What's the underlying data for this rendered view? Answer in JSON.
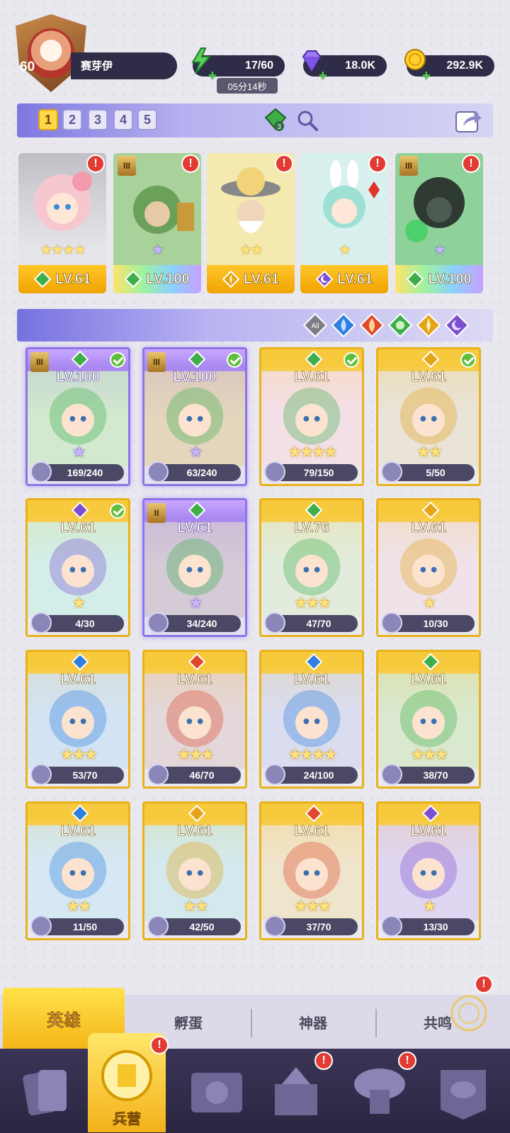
{
  "player": {
    "level": "60",
    "name": "赛芽伊"
  },
  "resources": {
    "energy": "17/60",
    "energy_timer": "05分14秒",
    "gems": "18.0K",
    "coins": "292.9K"
  },
  "team_tabs": [
    "1",
    "2",
    "3",
    "4",
    "5"
  ],
  "team_active_tab": "1",
  "team_gem_count": "3",
  "colors": {
    "green_element": "#3fae4a",
    "blue_element": "#2f7ee0",
    "red_element": "#e0482a",
    "gold_element": "#e5a31a",
    "purple_element": "#7a4fd0",
    "alert_red": "#e23b34",
    "nav_bg": "#2a2641",
    "accent_yellow": "#f5b619"
  },
  "team": [
    {
      "level": "LV.61",
      "element": "green",
      "stars": "★★★★",
      "alert": "!",
      "rank": ""
    },
    {
      "level": "LV.100",
      "element": "green",
      "stars": "★",
      "alert": "!",
      "rank": "III"
    },
    {
      "level": "LV.61",
      "element": "gold",
      "stars": "★★",
      "alert": "!",
      "rank": ""
    },
    {
      "level": "LV.61",
      "element": "purple",
      "stars": "★",
      "alert": "!",
      "rank": ""
    },
    {
      "level": "LV.100",
      "element": "green",
      "stars": "★",
      "alert": "!",
      "rank": "III"
    }
  ],
  "filter": {
    "all_label": "All",
    "elements": [
      "blue-element-icon",
      "red-element-icon",
      "green-element-icon",
      "gold-element-icon",
      "purple-element-icon"
    ]
  },
  "heroes": [
    {
      "level": "LV.100",
      "element": "green",
      "shards": "169/240",
      "frame": "purple",
      "check": true,
      "rank": "III",
      "stars": "★"
    },
    {
      "level": "LV.100",
      "element": "green",
      "shards": "63/240",
      "frame": "purple",
      "check": true,
      "rank": "III",
      "stars": "★"
    },
    {
      "level": "LV.61",
      "element": "green",
      "shards": "79/150",
      "frame": "gold",
      "check": true,
      "rank": "",
      "stars": "★★★★"
    },
    {
      "level": "LV.61",
      "element": "gold",
      "shards": "5/50",
      "frame": "gold",
      "check": true,
      "rank": "",
      "stars": "★★"
    },
    {
      "level": "LV.61",
      "element": "purple",
      "shards": "4/30",
      "frame": "gold",
      "check": true,
      "rank": "",
      "stars": "★"
    },
    {
      "level": "LV.61",
      "element": "green",
      "shards": "34/240",
      "frame": "purple",
      "check": false,
      "rank": "II",
      "stars": "★"
    },
    {
      "level": "LV.76",
      "element": "green",
      "shards": "47/70",
      "frame": "gold",
      "check": false,
      "rank": "",
      "stars": "★★★"
    },
    {
      "level": "LV.61",
      "element": "gold",
      "shards": "10/30",
      "frame": "gold",
      "check": false,
      "rank": "",
      "stars": "★"
    },
    {
      "level": "LV.61",
      "element": "blue",
      "shards": "53/70",
      "frame": "gold",
      "check": false,
      "rank": "",
      "stars": "★★★"
    },
    {
      "level": "LV.61",
      "element": "red",
      "shards": "46/70",
      "frame": "gold",
      "check": false,
      "rank": "",
      "stars": "★★★"
    },
    {
      "level": "LV.61",
      "element": "blue",
      "shards": "24/100",
      "frame": "gold",
      "check": false,
      "rank": "",
      "stars": "★★★★"
    },
    {
      "level": "LV.61",
      "element": "green",
      "shards": "38/70",
      "frame": "gold",
      "check": false,
      "rank": "",
      "stars": "★★★"
    },
    {
      "level": "LV.61",
      "element": "blue",
      "shards": "11/50",
      "frame": "gold",
      "check": false,
      "rank": "",
      "stars": "★★"
    },
    {
      "level": "LV.61",
      "element": "gold",
      "shards": "42/50",
      "frame": "gold",
      "check": false,
      "rank": "",
      "stars": "★★"
    },
    {
      "level": "LV.61",
      "element": "red",
      "shards": "37/70",
      "frame": "gold",
      "check": false,
      "rank": "",
      "stars": "★★★"
    },
    {
      "level": "LV.61",
      "element": "purple",
      "shards": "13/30",
      "frame": "gold",
      "check": false,
      "rank": "",
      "stars": "★"
    }
  ],
  "subtabs": [
    "英雄",
    "孵蛋",
    "神器",
    "共鸣"
  ],
  "bottom_nav": {
    "active_label": "兵营",
    "items": [
      "cards-icon",
      "barracks-icon",
      "journal-icon",
      "castle-icon",
      "mushroom-house-icon",
      "guild-banner-icon"
    ]
  }
}
